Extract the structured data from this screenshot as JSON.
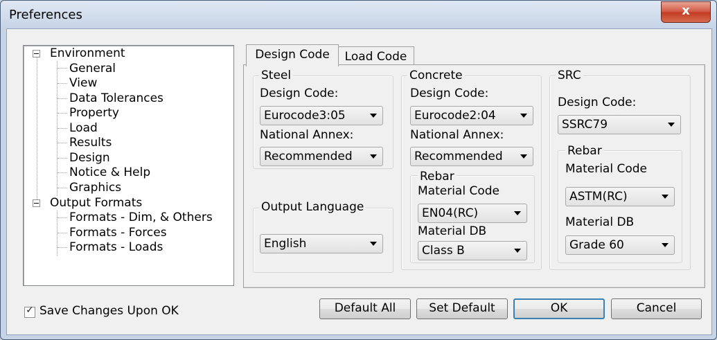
{
  "window": {
    "title": "Preferences",
    "close_label": "x"
  },
  "tree": {
    "groups": [
      {
        "label": "Environment",
        "children": [
          "General",
          "View",
          "Data Tolerances",
          "Property",
          "Load",
          "Results",
          "Design",
          "Notice & Help",
          "Graphics"
        ]
      },
      {
        "label": "Output Formats",
        "children": [
          "Formats - Dim, & Others",
          "Formats - Forces",
          "Formats - Loads"
        ]
      }
    ]
  },
  "tabs": [
    {
      "label": "Design Code",
      "active": true
    },
    {
      "label": "Load Code",
      "active": false
    }
  ],
  "steel": {
    "legend": "Steel",
    "design_code_label": "Design Code:",
    "design_code_value": "Eurocode3:05",
    "annex_label": "National Annex:",
    "annex_value": "Recommended"
  },
  "concrete": {
    "legend": "Concrete",
    "design_code_label": "Design Code:",
    "design_code_value": "Eurocode2:04",
    "annex_label": "National Annex:",
    "annex_value": "Recommended",
    "rebar": {
      "legend": "Rebar",
      "material_code_label": "Material Code",
      "material_code_value": "EN04(RC)",
      "material_db_label": "Material DB",
      "material_db_value": "Class B"
    }
  },
  "src": {
    "legend": "SRC",
    "design_code_label": "Design Code:",
    "design_code_value": "SSRC79",
    "rebar": {
      "legend": "Rebar",
      "material_code_label": "Material Code",
      "material_code_value": "ASTM(RC)",
      "material_db_label": "Material DB",
      "material_db_value": "Grade 60"
    }
  },
  "output_language": {
    "legend": "Output Language",
    "value": "English"
  },
  "save_changes": {
    "label": "Save Changes Upon OK",
    "checked": true
  },
  "buttons": {
    "default_all": "Default All",
    "set_default": "Set Default",
    "ok": "OK",
    "cancel": "Cancel"
  }
}
